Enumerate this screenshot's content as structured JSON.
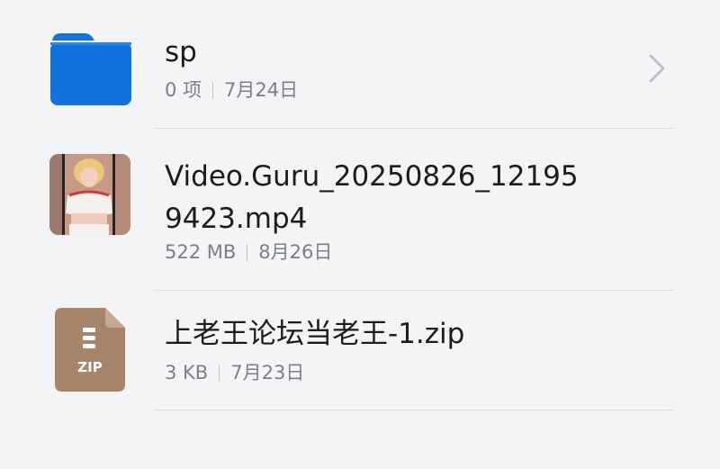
{
  "files": [
    {
      "name": "sp",
      "type": "folder",
      "icon": "folder-icon",
      "size": "0 项",
      "date": "7月24日",
      "has_chevron": true
    },
    {
      "name_line1": "Video.Guru_20250826_12195",
      "name_line2": "9423.mp4",
      "type": "video",
      "icon": "video-thumbnail",
      "size": "522 MB",
      "date": "8月26日"
    },
    {
      "name": "上老王论坛当老王-1.zip",
      "type": "zip",
      "icon": "zip-file-icon",
      "icon_label": "ZIP",
      "size": "3 KB",
      "date": "7月23日"
    }
  ],
  "colors": {
    "background": "#f3f4f6",
    "folder_blue": "#1273de",
    "zip_brown": "#a7856a",
    "primary_text": "#1c1c1e",
    "secondary_text": "#7c7f86"
  }
}
